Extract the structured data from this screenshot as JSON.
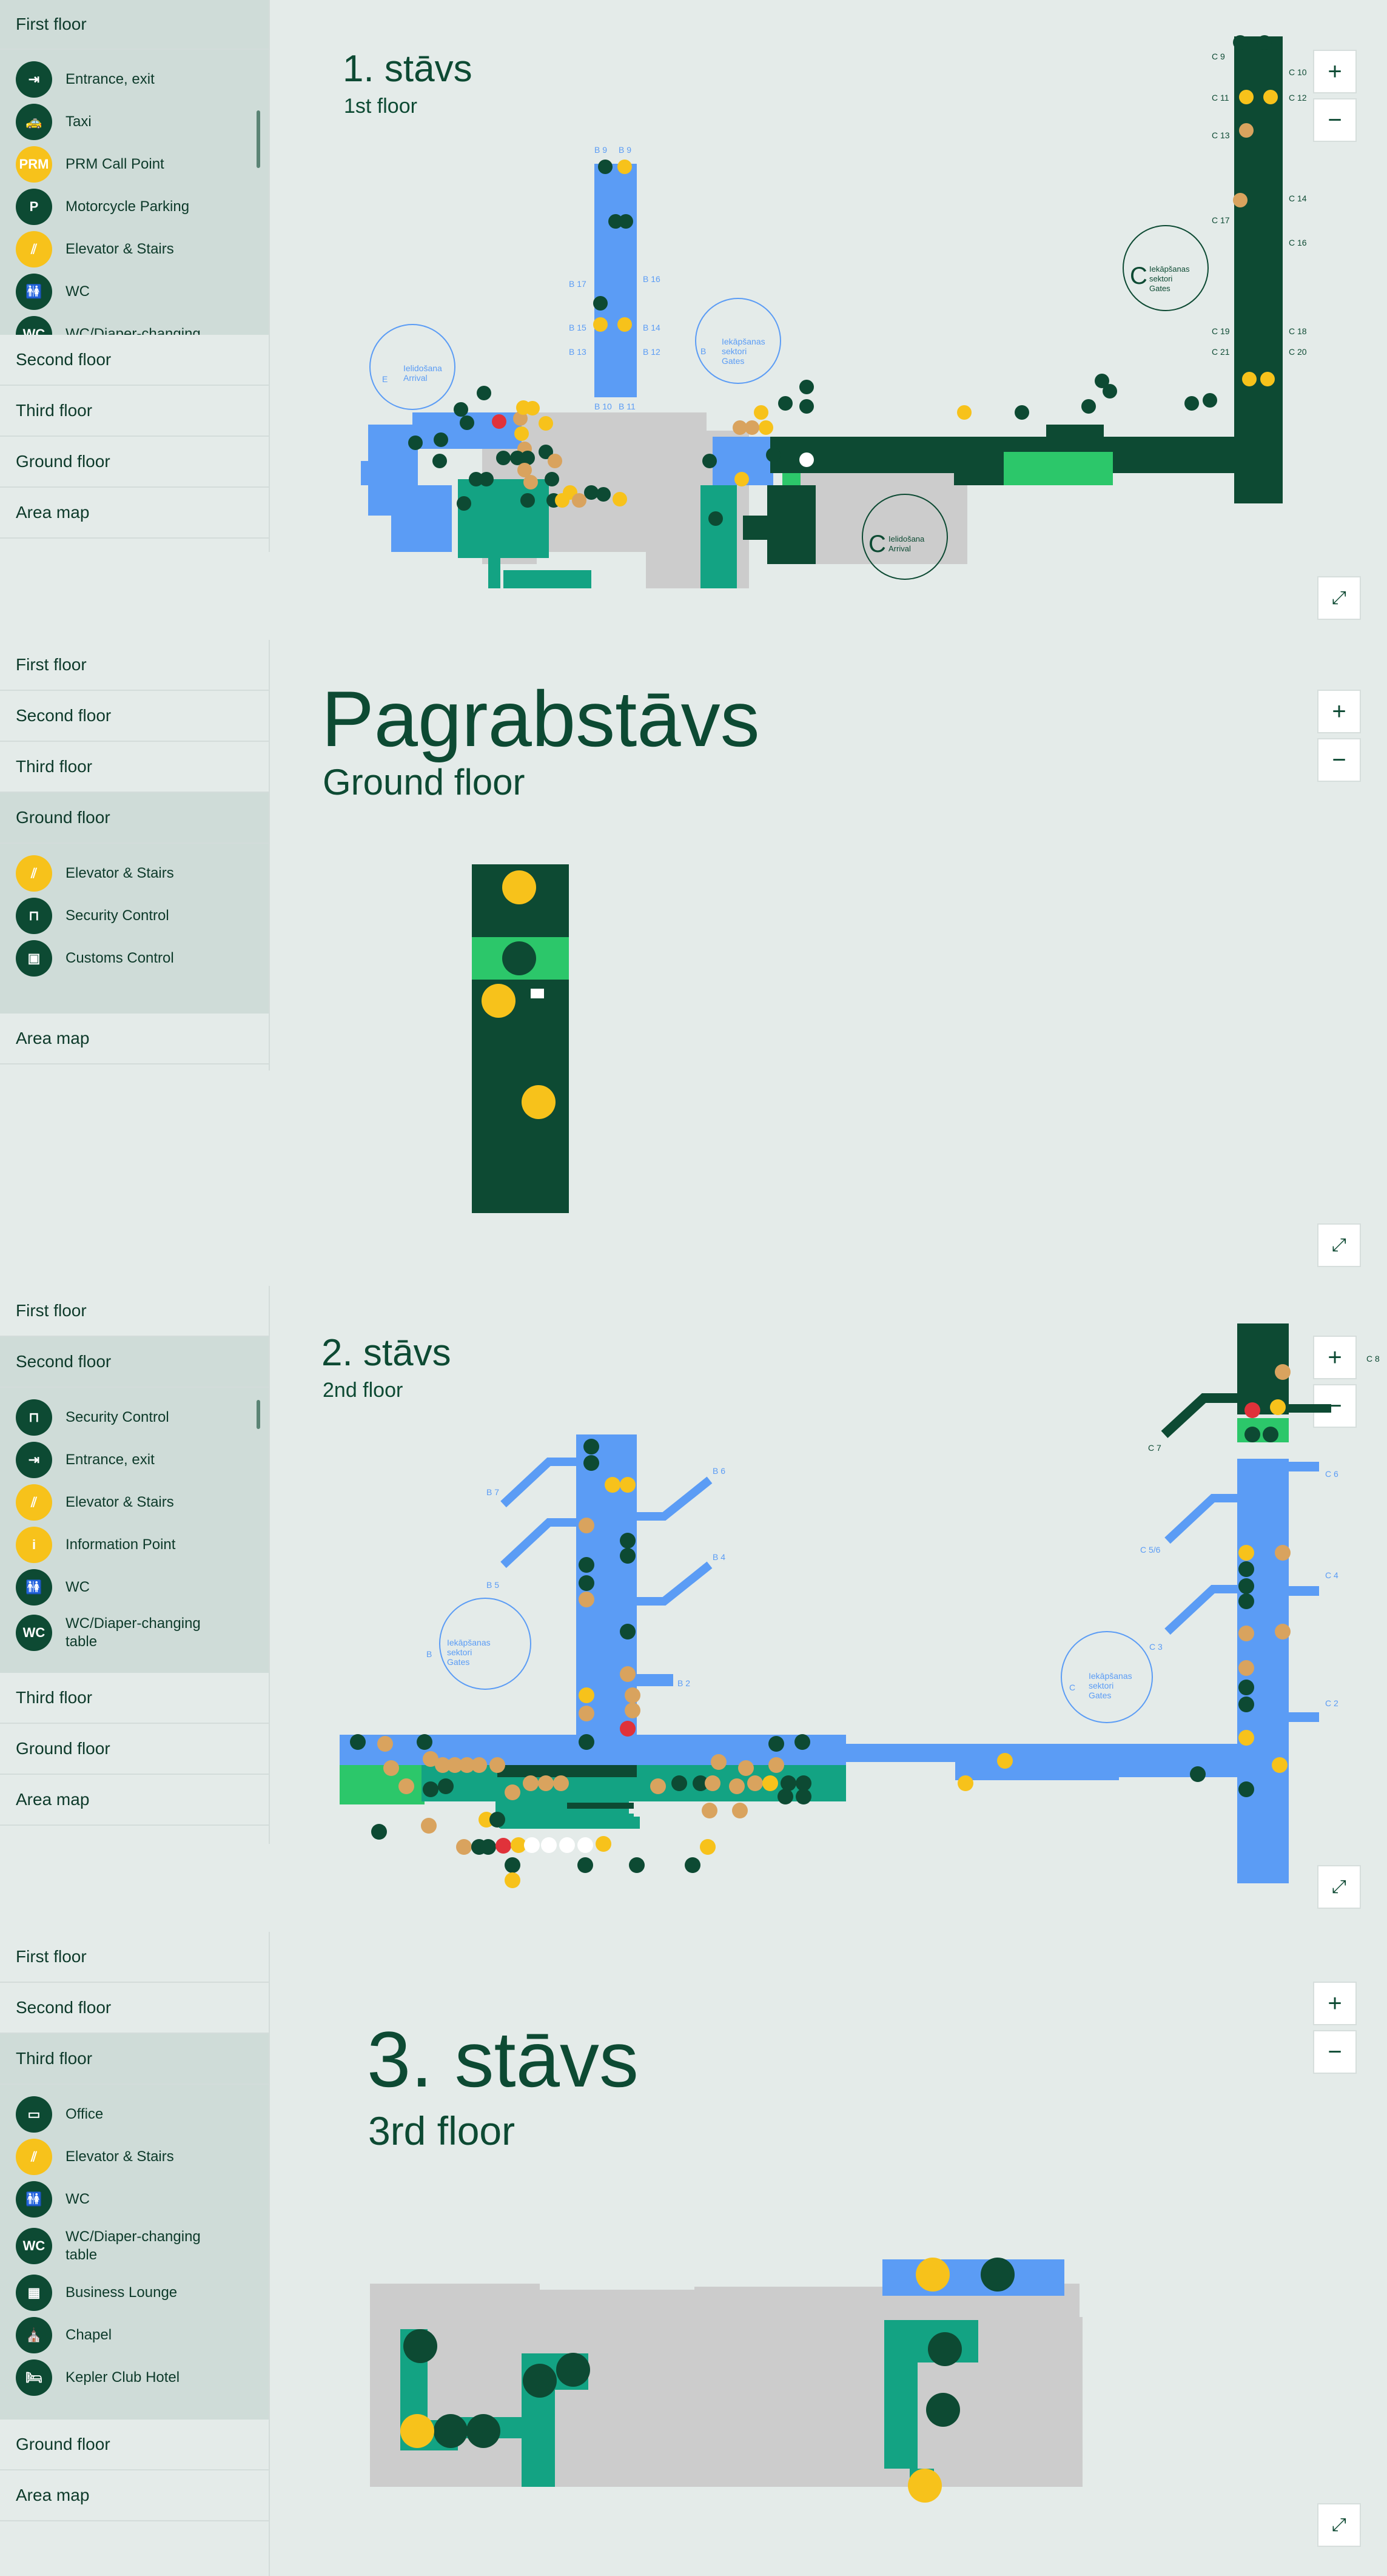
{
  "floors_nav": {
    "first": "First floor",
    "second": "Second floor",
    "third": "Third floor",
    "ground": "Ground floor",
    "area": "Area map"
  },
  "section1": {
    "title": "1. stāvs",
    "subtitle": "1st floor",
    "legend": [
      {
        "icon": "entrance-exit-icon",
        "label": "Entrance, exit"
      },
      {
        "icon": "taxi-icon",
        "label": "Taxi"
      },
      {
        "icon": "prm-icon",
        "label": "PRM Call Point",
        "glyph": "PRM"
      },
      {
        "icon": "motorcycle-icon",
        "label": "Motorcycle Parking"
      },
      {
        "icon": "elevator-stairs-icon",
        "label": "Elevator & Stairs"
      },
      {
        "icon": "wc-icon",
        "label": "WC"
      },
      {
        "icon": "wc-diaper-icon",
        "label": "WC/Diaper-changing"
      }
    ],
    "gate_labels": {
      "e_letter": "E",
      "e_arrival": "Ielidošana",
      "e_arrival_en": "Arrival",
      "b_letter": "B",
      "b_l1": "Iekāpšanas",
      "b_l2": "sektori",
      "b_l3": "Gates",
      "c_letter": "C",
      "c_arrival": "Ielidošana",
      "c_arrival_en": "Arrival",
      "c2_letter": "C",
      "c2_l1": "Iekāpšanas",
      "c2_l2": "sektori",
      "c2_l3": "Gates"
    },
    "gates": [
      "B 9",
      "B 9",
      "B 16",
      "B 17",
      "B 15",
      "B 14",
      "B 13",
      "B 12",
      "B 10",
      "B 11",
      "C 9",
      "C 10",
      "C 11",
      "C 12",
      "C 13",
      "C 14",
      "C 17",
      "C 16",
      "C 19",
      "C 18",
      "C 21",
      "C 20"
    ]
  },
  "section2": {
    "title": "Pagrabstāvs",
    "subtitle": "Ground floor",
    "legend": [
      {
        "icon": "elevator-stairs-icon",
        "label": "Elevator & Stairs"
      },
      {
        "icon": "security-control-icon",
        "label": "Security Control"
      },
      {
        "icon": "customs-control-icon",
        "label": "Customs Control"
      }
    ]
  },
  "section3": {
    "title": "2. stāvs",
    "subtitle": "2nd floor",
    "legend": [
      {
        "icon": "security-control-icon",
        "label": "Security Control"
      },
      {
        "icon": "entrance-exit-icon",
        "label": "Entrance, exit"
      },
      {
        "icon": "elevator-stairs-icon",
        "label": "Elevator & Stairs"
      },
      {
        "icon": "information-point-icon",
        "label": "Information Point"
      },
      {
        "icon": "wc-icon",
        "label": "WC"
      },
      {
        "icon": "wc-diaper-icon",
        "label": "WC/Diaper-changing table"
      }
    ],
    "gates": [
      "B 7",
      "B 6",
      "B 5",
      "B 4",
      "B 2",
      "C 7",
      "C 8",
      "C 6",
      "C 5/6",
      "C 4",
      "C 3",
      "C 2"
    ],
    "b_letter": "B",
    "b_l1": "Iekāpšanas",
    "b_l2": "sektori",
    "b_l3": "Gates",
    "c_letter": "C",
    "c_l1": "Iekāpšanas",
    "c_l2": "sektori",
    "c_l3": "Gates"
  },
  "section4": {
    "title": "3. stāvs",
    "subtitle": "3rd floor",
    "legend": [
      {
        "icon": "office-icon",
        "label": "Office"
      },
      {
        "icon": "elevator-stairs-icon",
        "label": "Elevator & Stairs"
      },
      {
        "icon": "wc-icon",
        "label": "WC"
      },
      {
        "icon": "wc-diaper-icon",
        "label": "WC/Diaper-changing table"
      },
      {
        "icon": "business-lounge-icon",
        "label": "Business Lounge"
      },
      {
        "icon": "chapel-icon",
        "label": "Chapel"
      },
      {
        "icon": "kepler-hotel-icon",
        "label": "Kepler Club Hotel"
      }
    ]
  },
  "controls": {
    "zoom_in": "+",
    "zoom_out": "−",
    "fullscreen": "⤢"
  },
  "colors": {
    "dark_green": "#0d4a33",
    "teal": "#13a383",
    "blue": "#5b9cf5",
    "grey": "#cccccc",
    "yellow": "#f7c21b",
    "light_green": "#2cc76a",
    "tan": "#d9a35e",
    "red": "#e0323a"
  }
}
